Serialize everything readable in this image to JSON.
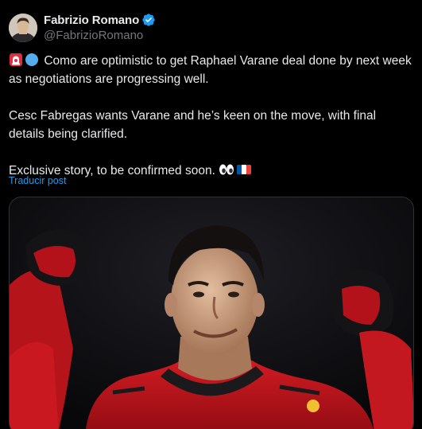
{
  "author": {
    "display_name": "Fabrizio Romano",
    "handle": "@FabrizioRomano",
    "verified": true,
    "avatar_icon": "profile-photo"
  },
  "tweet": {
    "paragraph_1": "Como are optimistic to get Raphael Varane deal done by next week as negotiations are progressing well.",
    "paragraph_1_emojis": [
      "siren-icon",
      "blue-circle-icon"
    ],
    "paragraph_2": "Cesc Fabregas wants Varane and he’s keen on the move, with final details being clarified.",
    "paragraph_3": "Exclusive story, to be confirmed soon.",
    "paragraph_3_emojis": [
      "eyes-icon",
      "france-flag-icon"
    ],
    "translate_label": "Traducir post"
  },
  "media": {
    "description_icon": "player-celebration-photo"
  },
  "colors": {
    "background": "#000000",
    "text": "#e7e9ea",
    "secondary": "#71767b",
    "link": "#1d9bf0",
    "verified": "#1d9bf0",
    "kit_red": "#c8161d"
  }
}
